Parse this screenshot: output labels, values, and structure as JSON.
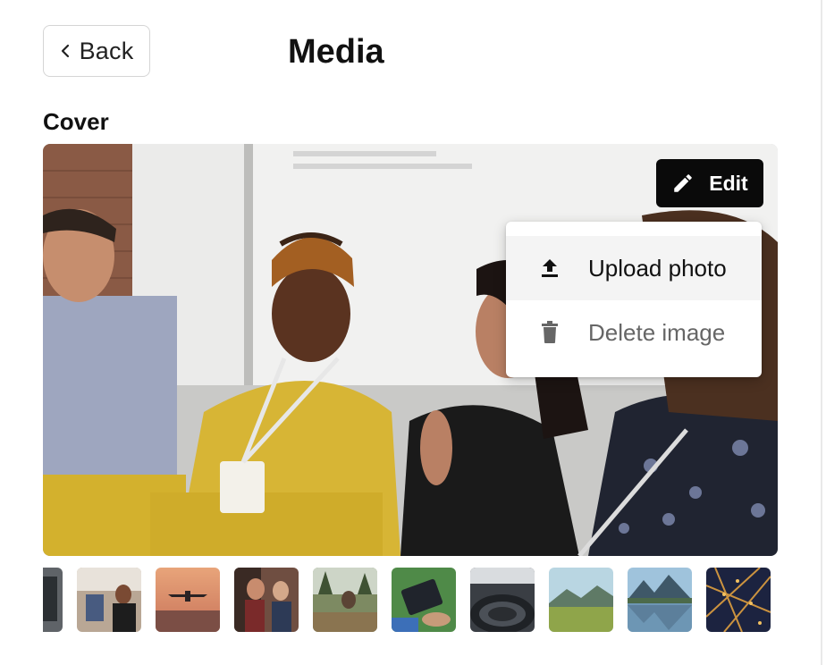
{
  "header": {
    "back_label": "Back",
    "title": "Media"
  },
  "cover": {
    "section_label": "Cover",
    "edit_label": "Edit",
    "menu": {
      "upload_label": "Upload photo",
      "delete_label": "Delete image"
    }
  },
  "icons": {
    "back": "chevron-left-icon",
    "edit": "pencil-icon",
    "upload": "upload-icon",
    "delete": "trash-icon"
  },
  "thumbnails": [
    {
      "subject": "studio equipment"
    },
    {
      "subject": "woman in workshop"
    },
    {
      "subject": "airplane landing at sunset"
    },
    {
      "subject": "people talking in office"
    },
    {
      "subject": "garden with forest"
    },
    {
      "subject": "hands holding tablet"
    },
    {
      "subject": "auditorium"
    },
    {
      "subject": "green meadow with mountains"
    },
    {
      "subject": "mountain lake reflection"
    },
    {
      "subject": "city lights aerial view"
    }
  ],
  "colors": {
    "edit_bg": "#0a0a0a",
    "menu_highlight": "#f4f4f4",
    "text_primary": "#111111",
    "text_muted": "#666666"
  }
}
